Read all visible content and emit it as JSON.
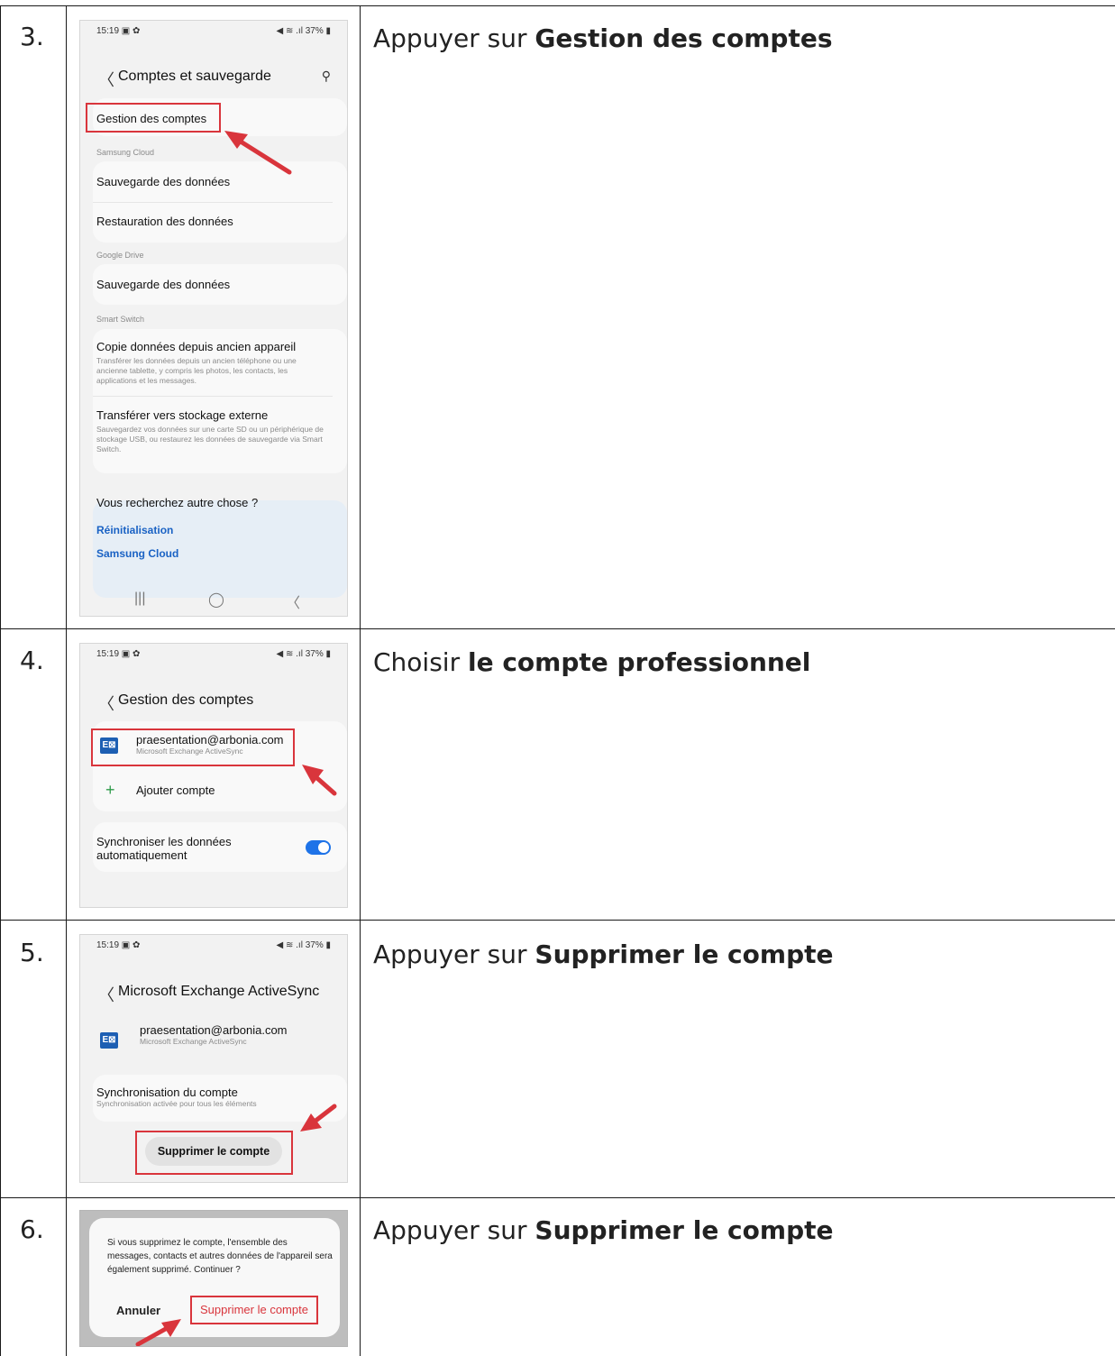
{
  "steps": [
    {
      "number": "3.",
      "instruction_prefix": "Appuyer sur ",
      "instruction_bold": "Gestion des comptes",
      "phone": {
        "status_time": "15:19",
        "status_right": "37%",
        "title": "Comptes et sauvegarde",
        "item_account_mgmt": "Gestion des comptes",
        "section_samsung_cloud": "Samsung Cloud",
        "item_backup_1": "Sauvegarde des données",
        "item_restore": "Restauration des données",
        "section_google_drive": "Google Drive",
        "item_backup_2": "Sauvegarde des données",
        "section_smart_switch": "Smart Switch",
        "item_copy": "Copie données depuis ancien appareil",
        "item_copy_desc": "Transférer les données depuis un ancien téléphone ou une ancienne tablette, y compris les photos, les contacts, les applications et les messages.",
        "item_transfer": "Transférer vers stockage externe",
        "item_transfer_desc": "Sauvegardez vos données sur une carte SD ou un périphérique de stockage USB, ou restaurez les données de sauvegarde via Smart Switch.",
        "help_title": "Vous recherchez autre chose ?",
        "help_link_1": "Réinitialisation",
        "help_link_2": "Samsung Cloud"
      }
    },
    {
      "number": "4.",
      "instruction_prefix": "Choisir ",
      "instruction_bold": "le compte professionnel",
      "phone": {
        "status_time": "15:19",
        "status_right": "37%",
        "title": "Gestion des comptes",
        "account_email": "praesentation@arbonia.com",
        "account_type": "Microsoft Exchange ActiveSync",
        "add_account": "Ajouter compte",
        "sync_label": "Synchroniser les données automatiquement",
        "sync_enabled": true
      }
    },
    {
      "number": "5.",
      "instruction_prefix": "Appuyer sur ",
      "instruction_bold": "Supprimer le compte",
      "phone": {
        "status_time": "15:19",
        "status_right": "37%",
        "title": "Microsoft Exchange ActiveSync",
        "account_email": "praesentation@arbonia.com",
        "account_type": "Microsoft Exchange ActiveSync",
        "sync_title": "Synchronisation du compte",
        "sync_desc": "Synchronisation activée pour tous les éléments",
        "delete_button": "Supprimer le compte"
      }
    },
    {
      "number": "6.",
      "instruction_prefix": "Appuyer sur ",
      "instruction_bold": "Supprimer le compte",
      "phone": {
        "dialog_text": "Si vous supprimez le compte, l'ensemble des messages, contacts et autres données de l'appareil sera également supprimé. Continuer ?",
        "cancel_button": "Annuler",
        "confirm_button": "Supprimer le compte"
      }
    }
  ],
  "colors": {
    "highlight_red": "#d9353c",
    "link_blue": "#1a62c4",
    "toggle_blue": "#1e73e8",
    "exchange_blue": "#1d5fb3"
  }
}
